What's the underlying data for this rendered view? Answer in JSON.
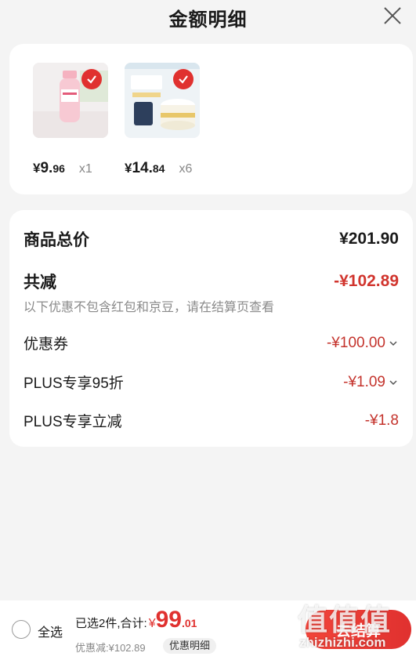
{
  "header": {
    "title": "金额明细"
  },
  "products": [
    {
      "icon": "drink-bottle-image",
      "price_yen": "¥",
      "price_int": "9.",
      "price_dec": "96",
      "qty": "x1"
    },
    {
      "icon": "formula-can-image",
      "price_yen": "¥",
      "price_int": "14.",
      "price_dec": "84",
      "qty": "x6"
    }
  ],
  "summary": {
    "total_label": "商品总价",
    "total_value": "¥201.90",
    "reduce_label": "共减",
    "reduce_value": "-¥102.89",
    "note": "以下优惠不包含红包和京豆，请在结算页查看",
    "coupon_label": "优惠券",
    "coupon_value": "-¥100.00",
    "plus95_label": "PLUS专享95折",
    "plus95_value": "-¥1.09",
    "plusinstant_label": "PLUS专享立减",
    "plusinstant_value": "-¥1.8"
  },
  "bottom": {
    "select_all": "全选",
    "selected_text": "已选2件,合计:",
    "total_yen": "¥",
    "total_int": "99",
    "total_dec": ".01",
    "discount_text": "优惠减:¥102.89",
    "detail_button": "优惠明细",
    "checkout_label": "去结算"
  },
  "watermark": {
    "logo": "值值值",
    "url": "zhizhizhi.com"
  },
  "colors": {
    "accent": "#e0312f",
    "discount": "#c4332c",
    "card": "#ffffff",
    "background": "#f4f4f4"
  }
}
